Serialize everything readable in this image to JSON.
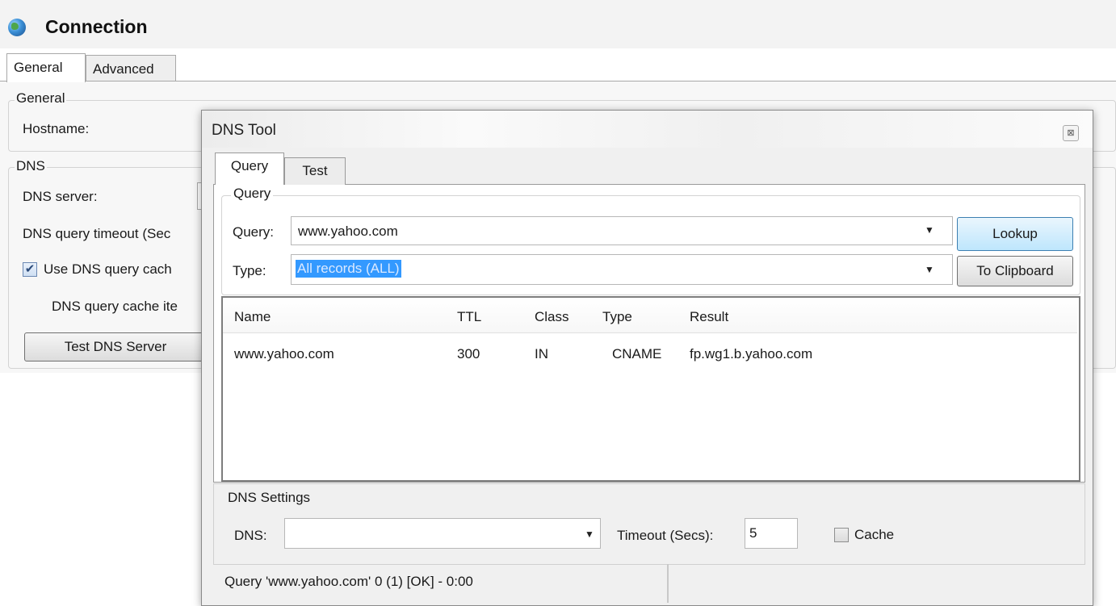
{
  "connection": {
    "title": "Connection",
    "tabs": [
      "General",
      "Advanced"
    ],
    "general_group": {
      "legend": "General",
      "hostname_label": "Hostname:"
    },
    "dns_group": {
      "legend": "DNS",
      "server_label": "DNS server:",
      "timeout_label": "DNS query timeout (Sec",
      "use_cache_label": "Use DNS query cach",
      "use_cache_checked": true,
      "cache_items_label": "DNS query cache ite",
      "test_button": "Test DNS Server"
    }
  },
  "dns_tool": {
    "title": "DNS Tool",
    "close_glyph": "⊠",
    "tabs": [
      "Query",
      "Test"
    ],
    "active_tab": "Query",
    "query_group": {
      "legend": "Query",
      "query_label": "Query:",
      "query_value": "www.yahoo.com",
      "type_label": "Type:",
      "type_value": "All records (ALL)",
      "lookup_button": "Lookup",
      "clipboard_button": "To Clipboard"
    },
    "results": {
      "columns": [
        "Name",
        "TTL",
        "Class",
        "Type",
        "Result"
      ],
      "rows": [
        [
          "www.yahoo.com",
          "300",
          "IN",
          "CNAME",
          "fp.wg1.b.yahoo.com"
        ]
      ]
    },
    "settings": {
      "legend": "DNS Settings",
      "dns_label": "DNS:",
      "dns_value": "",
      "timeout_label": "Timeout (Secs):",
      "timeout_value": "5",
      "cache_label": "Cache",
      "cache_checked": false
    },
    "status": "Query 'www.yahoo.com' 0 (1) [OK] - 0:00",
    "dropdown_glyph": "▼"
  },
  "colors": {
    "selection": "#3399ff",
    "lookup_button_border": "#3c7fb1"
  }
}
